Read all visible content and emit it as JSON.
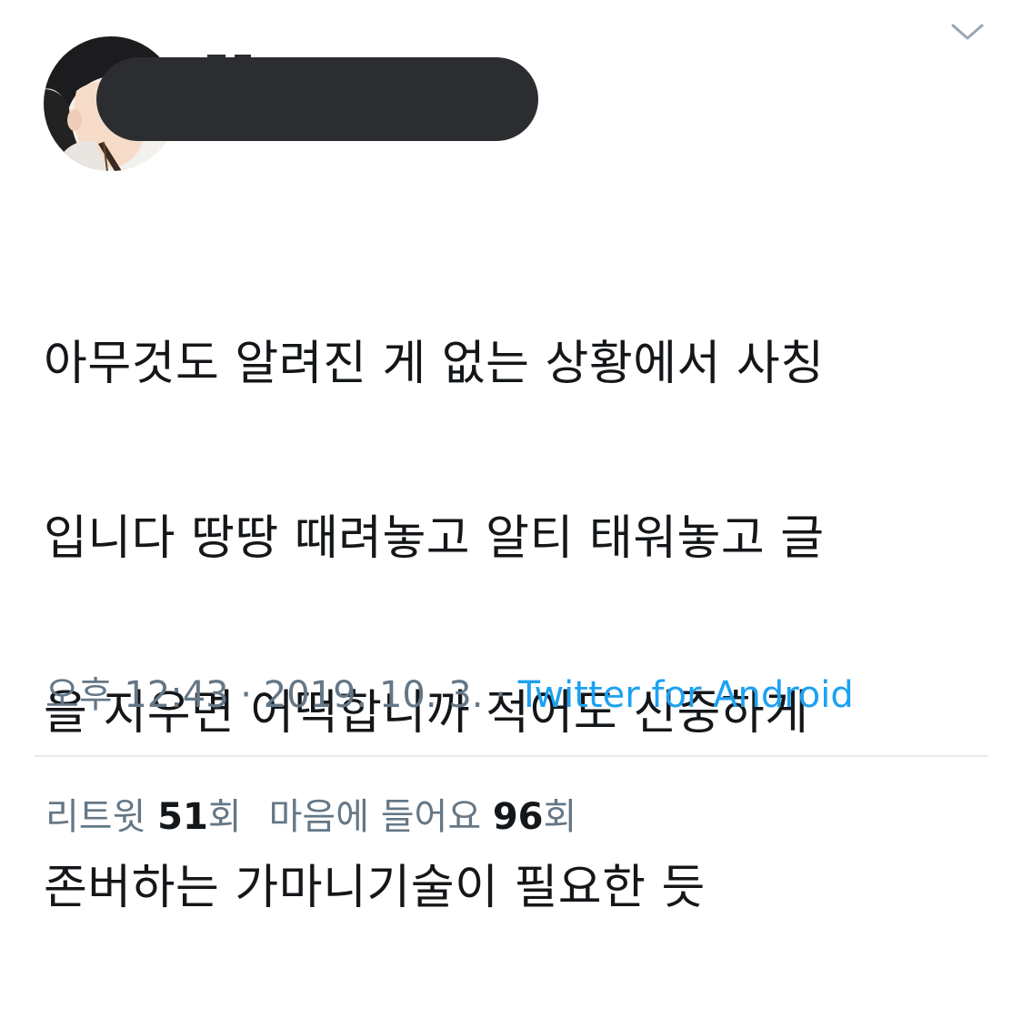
{
  "tweet": {
    "text_lines": [
      "아무것도 알려진 게 없는 상황에서 사칭",
      "입니다 땅땅 때려놓고 알티 태워놓고 글",
      "을 지우면 어떡합니까 적어도 신중하게",
      "존버하는 가마니기술이 필요한 듯"
    ],
    "time": "오후 12:43",
    "date": "2019. 10. 3.",
    "separator": " · ",
    "source": "Twitter for Android"
  },
  "stats": {
    "retweets_label": "리트윗",
    "retweets_count": "51",
    "retweets_unit": "회",
    "likes_label": "마음에 들어요",
    "likes_count": "96",
    "likes_unit": "회"
  },
  "icons": {
    "menu": "chevron-down-icon",
    "profile": "avatar"
  },
  "colors": {
    "text": "#14171a",
    "secondary": "#657786",
    "link": "#1da1f2",
    "divider": "#e6ecf0",
    "redaction": "#2b2d30"
  }
}
